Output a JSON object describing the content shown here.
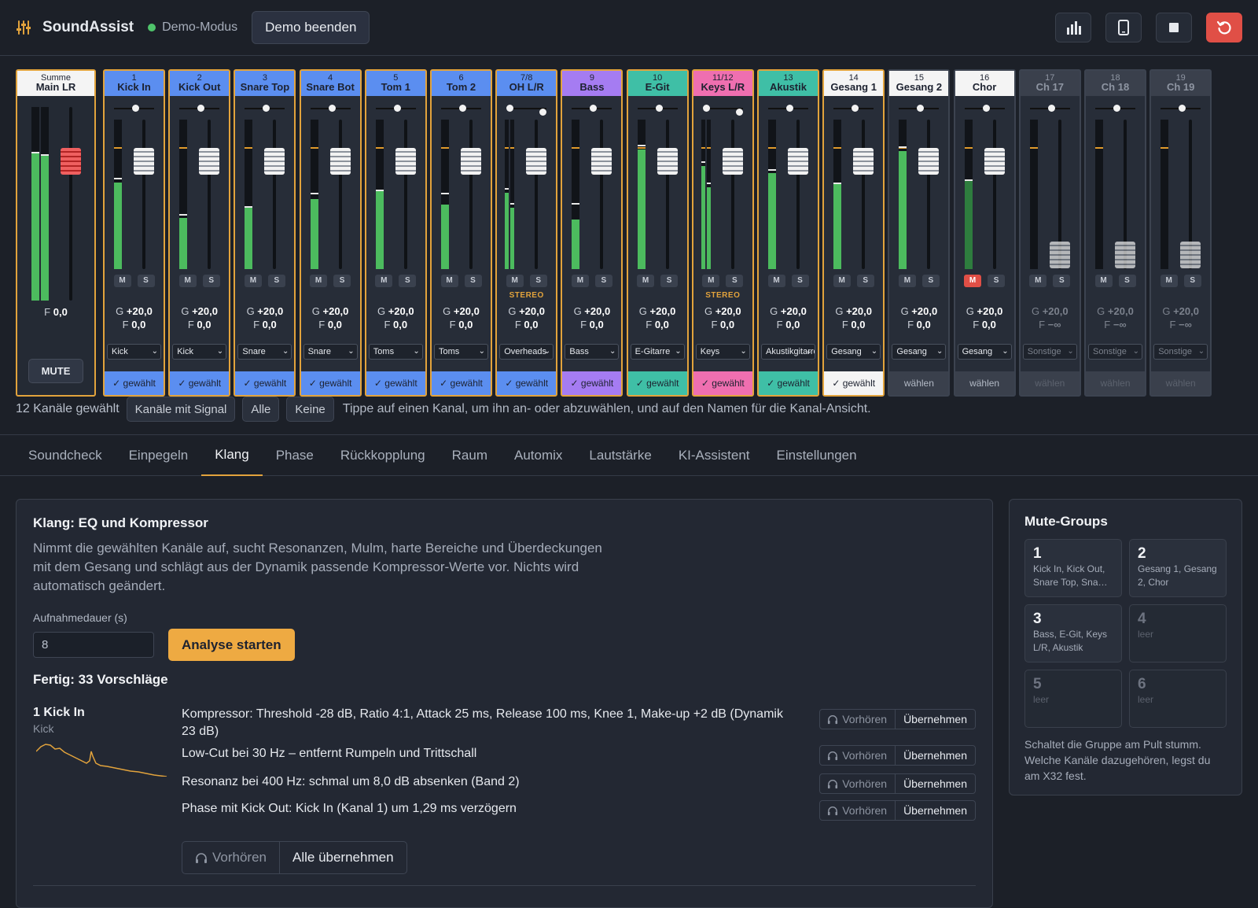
{
  "app": {
    "title": "SoundAssist",
    "mode": "Demo-Modus",
    "demo_end": "Demo beenden"
  },
  "colors": {
    "accent": "#e2a33c",
    "blue": "#5b8ef0",
    "purple": "#a57cf2",
    "teal": "#3fbfa6",
    "pink": "#ef6fb0",
    "white": "#f4f4f4",
    "gray": "#3a404c",
    "meter": "#4cbb5e",
    "mute_red": "#e04f46"
  },
  "header_icons": [
    "bar-chart-icon",
    "tablet-icon",
    "stop-icon",
    "reset-icon"
  ],
  "main": {
    "top": "Summe",
    "name": "Main LR",
    "fader": "F",
    "fader_val": "0,0",
    "mute": "MUTE"
  },
  "channels": [
    {
      "num": "1",
      "name": "Kick In",
      "color": "blue",
      "g": "+20,0",
      "f": "0,0",
      "sel": "Kick",
      "chosen": "✓ gewählt",
      "stereo": "",
      "mute": false,
      "selected": true,
      "level": 58,
      "peak": 60
    },
    {
      "num": "2",
      "name": "Kick Out",
      "color": "blue",
      "g": "+20,0",
      "f": "0,0",
      "sel": "Kick",
      "chosen": "✓ gewählt",
      "stereo": "",
      "mute": false,
      "selected": true,
      "level": 34,
      "peak": 36
    },
    {
      "num": "3",
      "name": "Snare Top",
      "color": "blue",
      "g": "+20,0",
      "f": "0,0",
      "sel": "Snare",
      "chosen": "✓ gewählt",
      "stereo": "",
      "mute": false,
      "selected": true,
      "level": 41,
      "peak": 41
    },
    {
      "num": "4",
      "name": "Snare Bot",
      "color": "blue",
      "g": "+20,0",
      "f": "0,0",
      "sel": "Snare",
      "chosen": "✓ gewählt",
      "stereo": "",
      "mute": false,
      "selected": true,
      "level": 47,
      "peak": 50
    },
    {
      "num": "5",
      "name": "Tom 1",
      "color": "blue",
      "g": "+20,0",
      "f": "0,0",
      "sel": "Toms",
      "chosen": "✓ gewählt",
      "stereo": "",
      "mute": false,
      "selected": true,
      "level": 52,
      "peak": 52
    },
    {
      "num": "6",
      "name": "Tom 2",
      "color": "blue",
      "g": "+20,0",
      "f": "0,0",
      "sel": "Toms",
      "chosen": "✓ gewählt",
      "stereo": "",
      "mute": false,
      "selected": true,
      "level": 43,
      "peak": 50
    },
    {
      "num": "7/8",
      "name": "OH L/R",
      "color": "blue",
      "g": "+20,0",
      "f": "0,0",
      "sel": "Overheads",
      "chosen": "✓ gewählt",
      "stereo": "STEREO",
      "mute": false,
      "selected": true,
      "level": 51,
      "peak": 53
    },
    {
      "num": "9",
      "name": "Bass",
      "color": "purple",
      "g": "+20,0",
      "f": "0,0",
      "sel": "Bass",
      "chosen": "✓ gewählt",
      "stereo": "",
      "mute": false,
      "selected": true,
      "level": 33,
      "peak": 43
    },
    {
      "num": "10",
      "name": "E-Git",
      "color": "teal",
      "g": "+20,0",
      "f": "0,0",
      "sel": "E-Gitarre",
      "chosen": "✓ gewählt",
      "stereo": "",
      "mute": false,
      "selected": true,
      "level": 80,
      "peak": 82
    },
    {
      "num": "11/12",
      "name": "Keys L/R",
      "color": "pink",
      "g": "+20,0",
      "f": "0,0",
      "sel": "Keys",
      "chosen": "✓ gewählt",
      "stereo": "STEREO",
      "mute": false,
      "selected": true,
      "level": 69,
      "peak": 71
    },
    {
      "num": "13",
      "name": "Akustik",
      "color": "teal",
      "g": "+20,0",
      "f": "0,0",
      "sel": "Akustikgitarre",
      "chosen": "✓ gewählt",
      "stereo": "",
      "mute": false,
      "selected": true,
      "level": 64,
      "peak": 66
    },
    {
      "num": "14",
      "name": "Gesang 1",
      "color": "white",
      "g": "+20,0",
      "f": "0,0",
      "sel": "Gesang",
      "chosen": "✓ gewählt",
      "stereo": "",
      "mute": false,
      "selected": true,
      "level": 57,
      "peak": 57
    },
    {
      "num": "15",
      "name": "Gesang 2",
      "color": "white",
      "g": "+20,0",
      "f": "0,0",
      "sel": "Gesang",
      "chosen": "wählen",
      "stereo": "",
      "mute": false,
      "selected": false,
      "level": 79,
      "peak": 81
    },
    {
      "num": "16",
      "name": "Chor",
      "color": "white",
      "g": "+20,0",
      "f": "0,0",
      "sel": "Gesang",
      "chosen": "wählen",
      "stereo": "",
      "mute": true,
      "selected": false,
      "level": 59,
      "peak": 59
    },
    {
      "num": "17",
      "name": "Ch 17",
      "color": "gray",
      "g": "+20,0",
      "f": "−∞",
      "sel": "Sonstige",
      "chosen": "wählen",
      "stereo": "",
      "mute": false,
      "selected": false,
      "level": 0,
      "peak": 0
    },
    {
      "num": "18",
      "name": "Ch 18",
      "color": "gray",
      "g": "+20,0",
      "f": "−∞",
      "sel": "Sonstige",
      "chosen": "wählen",
      "stereo": "",
      "mute": false,
      "selected": false,
      "level": 0,
      "peak": 0
    },
    {
      "num": "19",
      "name": "Ch 19",
      "color": "gray",
      "g": "+20,0",
      "f": "−∞",
      "sel": "Sonstige",
      "chosen": "wählen",
      "stereo": "",
      "mute": false,
      "selected": false,
      "level": 0,
      "peak": 0
    }
  ],
  "selection": {
    "count": "12 Kanäle gewählt",
    "signal": "Kanäle mit Signal",
    "all": "Alle",
    "none": "Keine",
    "hint": "Tippe auf einen Kanal, um ihn an- oder abzuwählen, und auf den Namen für die Kanal-Ansicht."
  },
  "tabs": [
    "Soundcheck",
    "Einpegeln",
    "Klang",
    "Phase",
    "Rückkopplung",
    "Raum",
    "Automix",
    "Lautstärke",
    "KI-Assistent",
    "Einstellungen"
  ],
  "active_tab": "Klang",
  "klang": {
    "title": "Klang: EQ und Kompressor",
    "desc": "Nimmt die gewählten Kanäle auf, sucht Resonanzen, Mulm, harte Bereiche und Überdeckungen mit dem Gesang und schlägt aus der Dynamik passende Kompressor-Werte vor. Nichts wird automatisch geändert.",
    "duration_label": "Aufnahmedauer (s)",
    "duration_value": "8",
    "start": "Analyse starten",
    "done": "Fertig: 33 Vorschläge",
    "channel_name": "1 Kick In",
    "channel_cat": "Kick",
    "suggestions": [
      "Kompressor: Threshold -28 dB, Ratio 4:1, Attack 25 ms, Release 100 ms, Knee 1, Make-up +2 dB (Dynamik 23 dB)",
      "Low-Cut bei 30 Hz – entfernt Rumpeln und Trittschall",
      "Resonanz bei 400 Hz: schmal um 8,0 dB absenken (Band 2)",
      "Phase mit Kick Out: Kick In (Kanal 1) um 1,29 ms verzögern"
    ],
    "preview": "Vorhören",
    "apply": "Übernehmen",
    "apply_all": "Alle übernehmen"
  },
  "mute_groups": {
    "title": "Mute-Groups",
    "groups": [
      {
        "n": "1",
        "members": "Kick In, Kick Out, Snare Top, Sna…",
        "empty": false
      },
      {
        "n": "2",
        "members": "Gesang 1, Gesang 2, Chor",
        "empty": false
      },
      {
        "n": "3",
        "members": "Bass, E-Git, Keys L/R, Akustik",
        "empty": false
      },
      {
        "n": "4",
        "members": "leer",
        "empty": true
      },
      {
        "n": "5",
        "members": "leer",
        "empty": true
      },
      {
        "n": "6",
        "members": "leer",
        "empty": true
      }
    ],
    "note": "Schaltet die Gruppe am Pult stumm. Welche Kanäle dazugehören, legst du am X32 fest."
  }
}
